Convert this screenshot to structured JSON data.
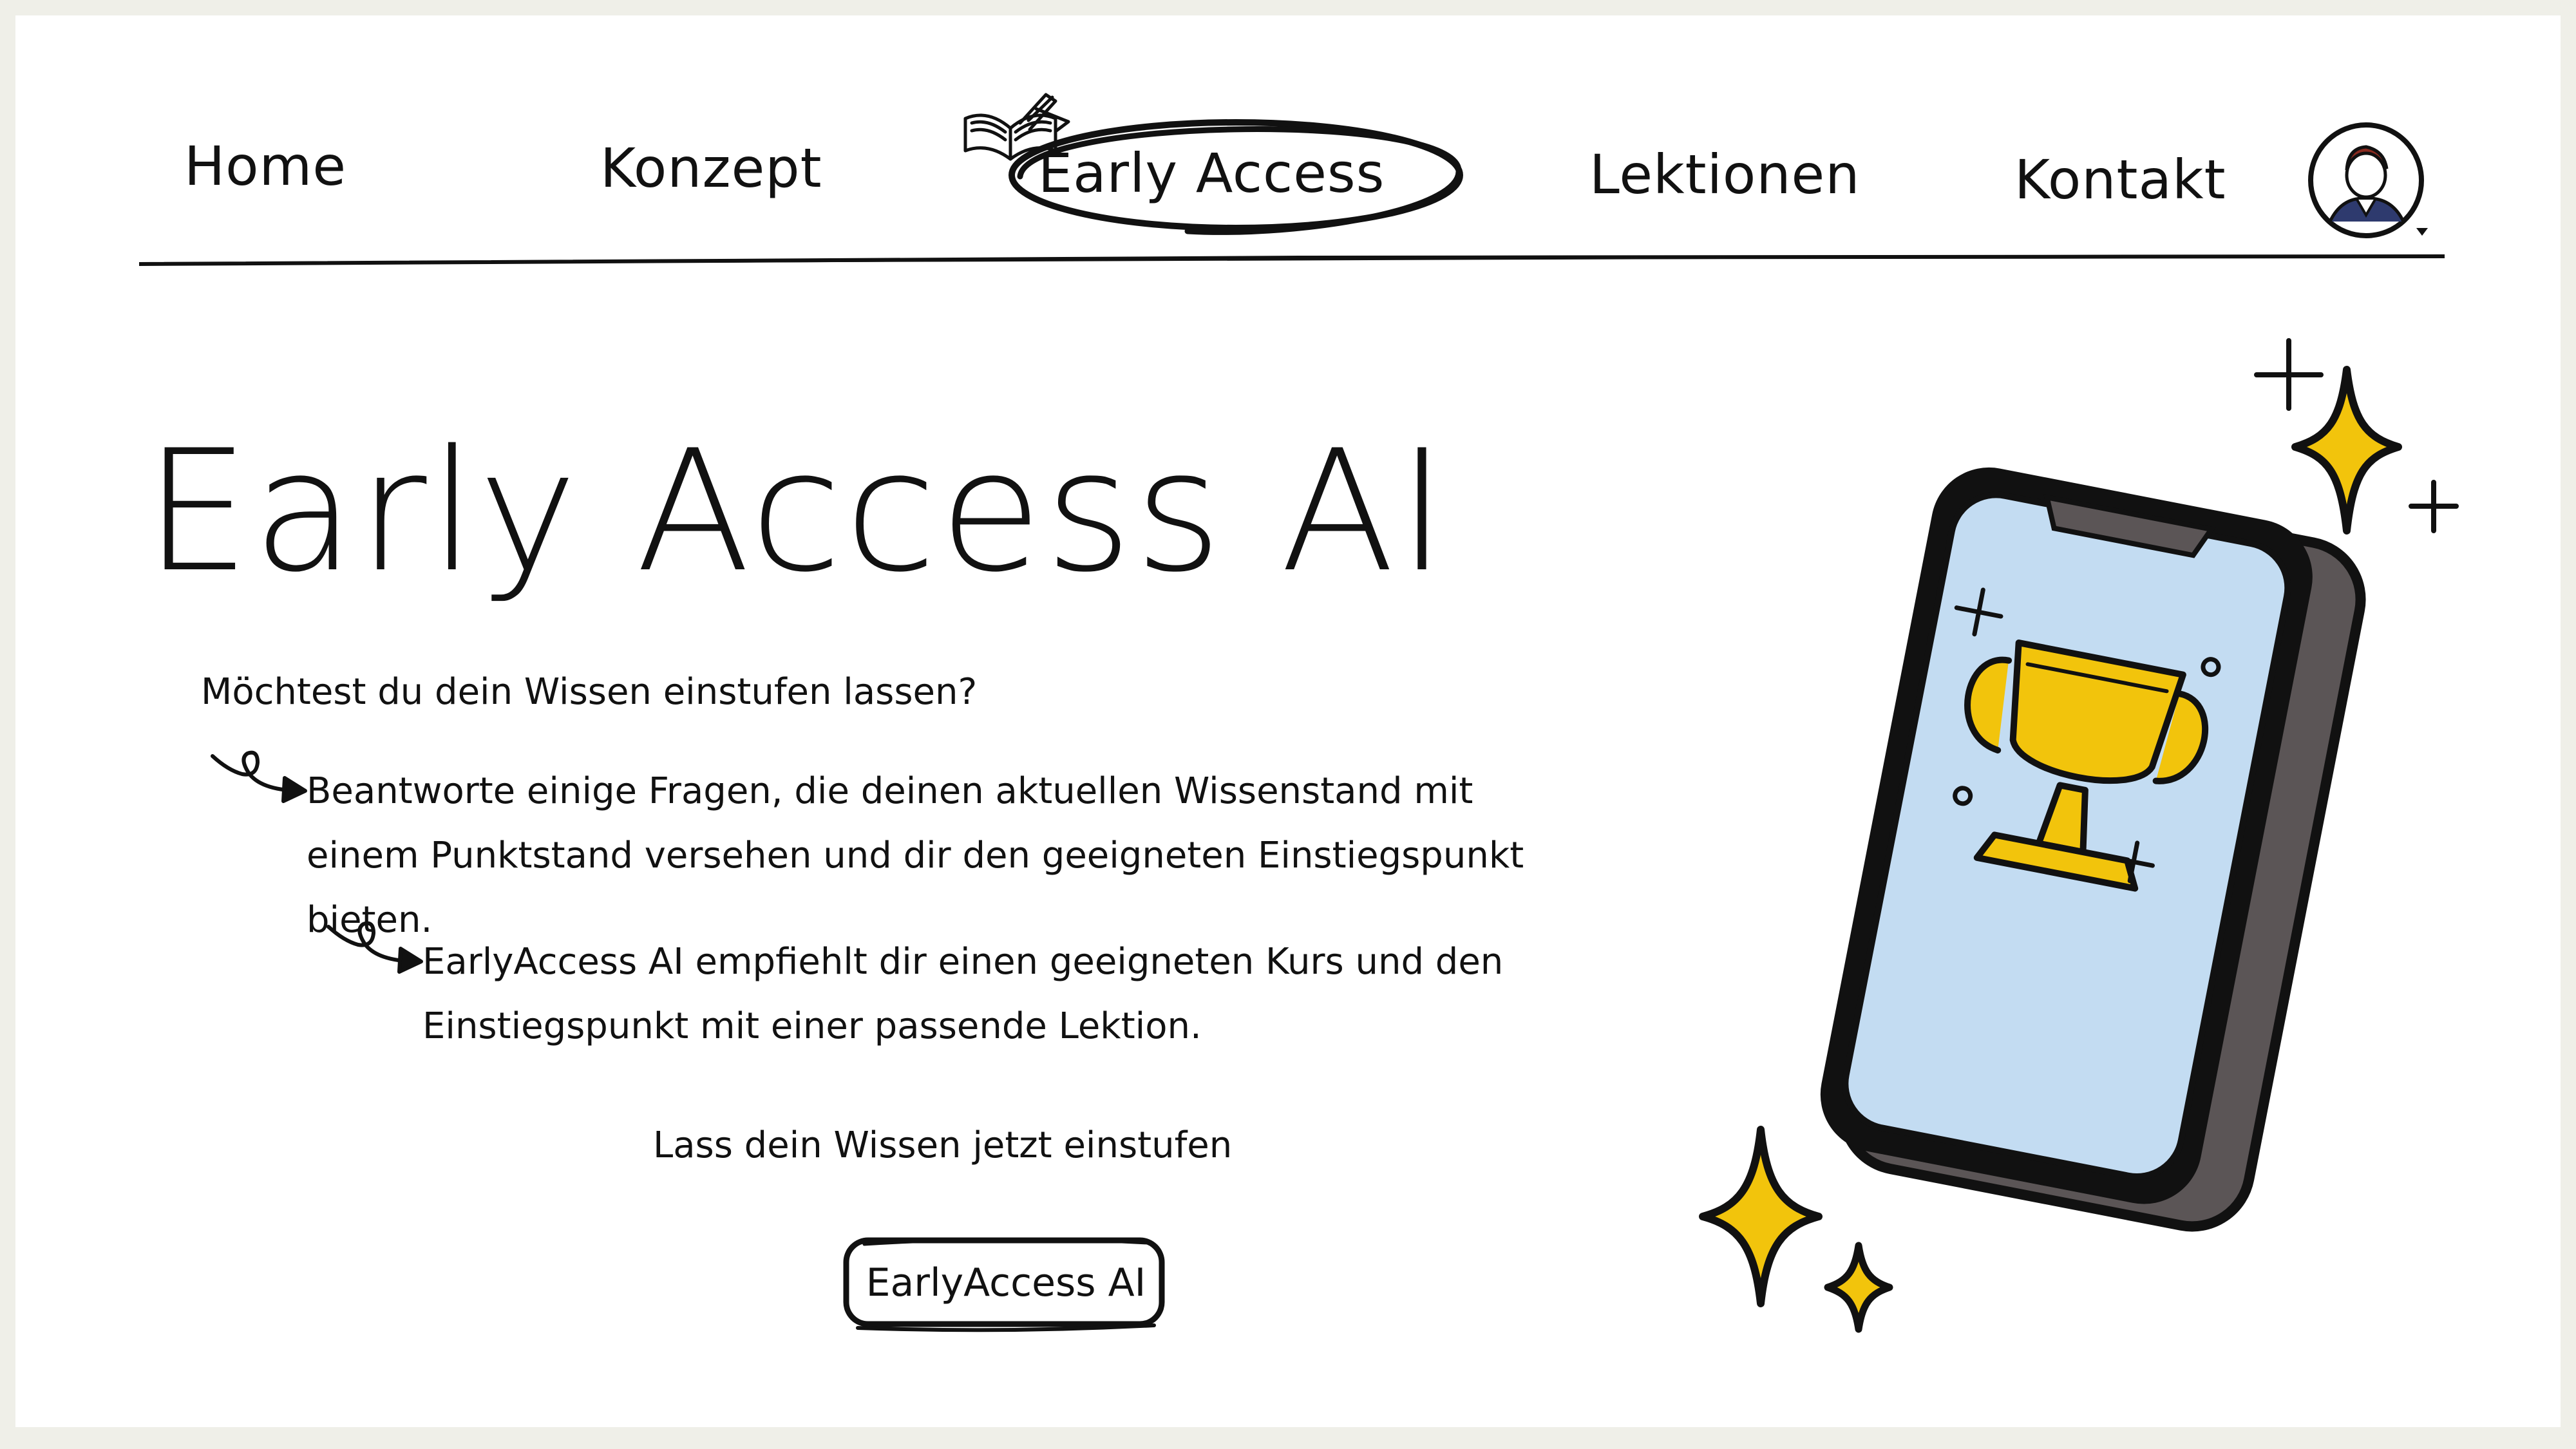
{
  "nav": {
    "items": [
      {
        "label": "Home"
      },
      {
        "label": "Konzept"
      },
      {
        "label": "Early Access",
        "active": true
      },
      {
        "label": "Lektionen"
      },
      {
        "label": "Kontakt"
      }
    ],
    "active_index": 2
  },
  "hero": {
    "title": "Early Access AI",
    "question": "Möchtest du dein Wissen einstufen lassen?",
    "bullets": [
      "Beantworte einige Fragen, die deinen aktuellen Wissenstand mit einem Punktstand versehen und dir den geeigneten Einstiegspunkt bieten.",
      "EarlyAccess AI empfiehlt dir einen geeigneten Kurs und den Einstiegspunkt mit einer passende Lektion."
    ],
    "cta_prompt": "Lass dein Wissen jetzt einstufen",
    "cta_button": "EarlyAccess AI"
  },
  "icons": {
    "book": "open-book-icon",
    "avatar": "user-avatar-icon",
    "arrow": "curly-arrow-icon",
    "phone": "smartphone-illustration",
    "trophy": "trophy-icon",
    "sparkle": "sparkle-icon"
  },
  "colors": {
    "ink": "#111111",
    "background": "#efefe8",
    "screen": "#c3dcf2",
    "phone_body": "#5b5556",
    "gold": "#f2c40c"
  }
}
